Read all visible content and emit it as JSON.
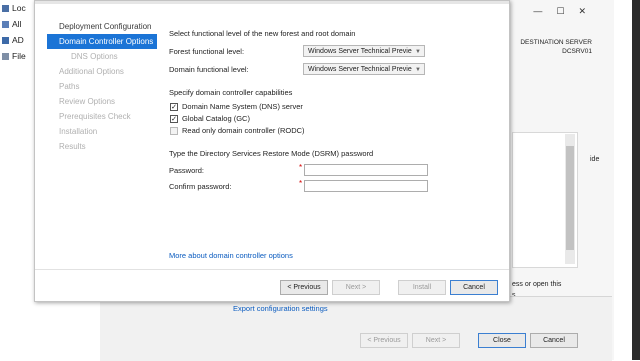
{
  "background": {
    "left_items": [
      {
        "label": "Loc",
        "icon": "local-server-icon"
      },
      {
        "label": "All",
        "icon": "all-servers-icon"
      },
      {
        "label": "AD",
        "icon": "ad-ds-icon"
      },
      {
        "label": "File",
        "icon": "file-services-icon"
      }
    ],
    "destination_label": "DESTINATION SERVER",
    "destination_server": "DCSRV01",
    "side_text": "ide",
    "side_text2_line1": "ess or open this",
    "side_text2_line2": "s.",
    "export_link": "Export configuration settings",
    "buttons": {
      "previous": "< Previous",
      "next": "Next >",
      "close": "Close",
      "cancel": "Cancel"
    }
  },
  "dialog": {
    "server_label": "DCSRV01",
    "nav": [
      {
        "label": "Deployment Configuration",
        "state": "normal"
      },
      {
        "label": "Domain Controller Options",
        "state": "active"
      },
      {
        "label": "DNS Options",
        "state": "dim"
      },
      {
        "label": "Additional Options",
        "state": "dim"
      },
      {
        "label": "Paths",
        "state": "dim"
      },
      {
        "label": "Review Options",
        "state": "dim"
      },
      {
        "label": "Prerequisites Check",
        "state": "dim"
      },
      {
        "label": "Installation",
        "state": "dim"
      },
      {
        "label": "Results",
        "state": "dim"
      }
    ],
    "functional_level_heading": "Select functional level of the new forest and root domain",
    "forest_level_label": "Forest functional level:",
    "forest_level_value": "Windows Server Technical Previe",
    "domain_level_label": "Domain functional level:",
    "domain_level_value": "Windows Server Technical Previe",
    "capabilities_heading": "Specify domain controller capabilities",
    "capabilities": [
      {
        "label": "Domain Name System (DNS) server",
        "checked": true,
        "enabled": true
      },
      {
        "label": "Global Catalog (GC)",
        "checked": true,
        "enabled": true
      },
      {
        "label": "Read only domain controller (RODC)",
        "checked": false,
        "enabled": true
      }
    ],
    "dsrm_heading": "Type the Directory Services Restore Mode (DSRM) password",
    "password_label": "Password:",
    "confirm_label": "Confirm password:",
    "required_marker": "*",
    "more_link": "More about domain controller options",
    "buttons": {
      "previous": "< Previous",
      "next": "Next >",
      "install": "Install",
      "cancel": "Cancel"
    }
  }
}
